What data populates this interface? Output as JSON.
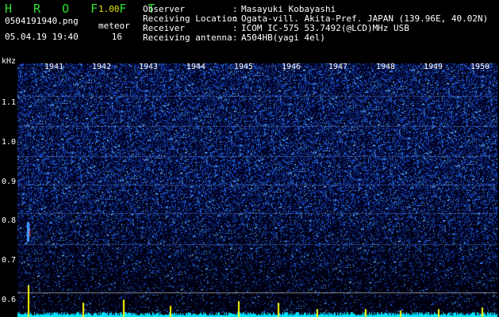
{
  "header": {
    "app_title": "H R O F F T",
    "version": "1.00",
    "filename": "0504191940.png",
    "timestamp": "05.04.19 19:40",
    "meteor_label": "meteor",
    "meteor_count": "16"
  },
  "info": [
    {
      "key": "Observer",
      "sep": ":",
      "value": "Masayuki Kobayashi"
    },
    {
      "key": "Receiving Location",
      "sep": ":",
      "value": "Ogata-vill. Akita-Pref. JAPAN (139.96E, 40.02N)"
    },
    {
      "key": "Receiver",
      "sep": ":",
      "value": "ICOM IC-575 53.7492(@LCD)MHz USB"
    },
    {
      "key": "Receiving antenna",
      "sep": ":",
      "value": "A504HB(yagi 4el)"
    }
  ],
  "axis": {
    "y_unit": "kHz",
    "y_ticks": [
      "1.1",
      "1.0",
      "0.9",
      "0.8",
      "0.7",
      "0.6"
    ],
    "y_values": [
      1.1,
      1.0,
      0.9,
      0.8,
      0.7,
      0.6
    ],
    "x_ticks": [
      "1941",
      "1942",
      "1943",
      "1944",
      "1945",
      "1946",
      "1947",
      "1948",
      "1949",
      "1950"
    ]
  },
  "colors": {
    "background": "#000000",
    "label_green": "#2ee02e",
    "version_yellow": "#e8e800",
    "noise_blue": "#1a3cff",
    "level_cyan": "#00e5ff",
    "meteor_yellow": "#ffff00"
  }
}
